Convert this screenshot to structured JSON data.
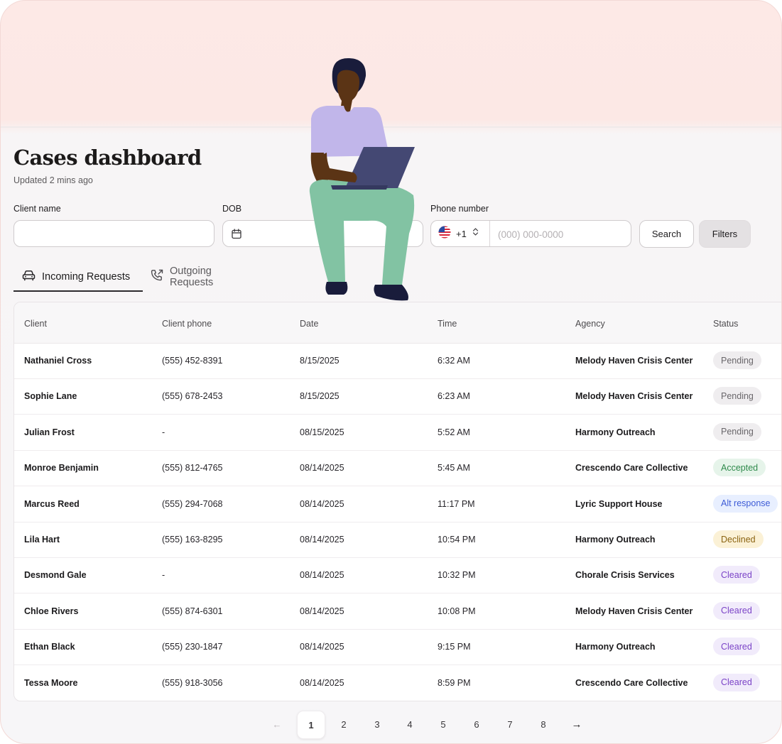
{
  "page": {
    "title": "Cases dashboard",
    "updated": "Updated 2 mins ago"
  },
  "search_form": {
    "client_name_label": "Client name",
    "client_name_value": "",
    "dob_label": "DOB",
    "dob_value": "",
    "phone_label": "Phone number",
    "country_code": "+1",
    "phone_placeholder": "(000) 000-0000",
    "phone_value": "",
    "search_button": "Search",
    "filters_button": "Filters"
  },
  "tabs": [
    {
      "label": "Incoming Requests",
      "icon": "car-icon",
      "active": true
    },
    {
      "label": "Outgoing Requests",
      "icon": "phone-outgoing-icon",
      "active": false
    }
  ],
  "table": {
    "columns": [
      "Client",
      "Client phone",
      "Date",
      "Time",
      "Agency",
      "Status"
    ],
    "rows": [
      {
        "client": "Nathaniel Cross",
        "phone": "(555) 452-8391",
        "date": "8/15/2025",
        "time": "6:32 AM",
        "agency": "Melody Haven Crisis Center",
        "status": "Pending"
      },
      {
        "client": "Sophie Lane",
        "phone": "(555) 678-2453",
        "date": "8/15/2025",
        "time": "6:23 AM",
        "agency": "Melody Haven Crisis Center",
        "status": "Pending"
      },
      {
        "client": "Julian Frost",
        "phone": "-",
        "date": "08/15/2025",
        "time": "5:52 AM",
        "agency": "Harmony Outreach",
        "status": "Pending"
      },
      {
        "client": "Monroe Benjamin",
        "phone": "(555) 812-4765",
        "date": "08/14/2025",
        "time": "5:45 AM",
        "agency": "Crescendo Care Collective",
        "status": "Accepted"
      },
      {
        "client": "Marcus Reed",
        "phone": "(555) 294-7068",
        "date": "08/14/2025",
        "time": "11:17 PM",
        "agency": "Lyric Support House",
        "status": "Alt response"
      },
      {
        "client": "Lila Hart",
        "phone": "(555) 163-8295",
        "date": "08/14/2025",
        "time": "10:54 PM",
        "agency": "Harmony Outreach",
        "status": "Declined"
      },
      {
        "client": "Desmond Gale",
        "phone": "-",
        "date": "08/14/2025",
        "time": "10:32 PM",
        "agency": "Chorale Crisis Services",
        "status": "Cleared"
      },
      {
        "client": "Chloe Rivers",
        "phone": "(555) 874-6301",
        "date": "08/14/2025",
        "time": "10:08 PM",
        "agency": "Melody Haven Crisis Center",
        "status": "Cleared"
      },
      {
        "client": "Ethan Black",
        "phone": "(555) 230-1847",
        "date": "08/14/2025",
        "time": "9:15 PM",
        "agency": "Harmony Outreach",
        "status": "Cleared"
      },
      {
        "client": "Tessa Moore",
        "phone": "(555) 918-3056",
        "date": "08/14/2025",
        "time": "8:59 PM",
        "agency": "Crescendo Care Collective",
        "status": "Cleared"
      }
    ]
  },
  "pagination": {
    "prev": "←",
    "next": "→",
    "pages": [
      "1",
      "2",
      "3",
      "4",
      "5",
      "6",
      "7",
      "8"
    ],
    "current": "1"
  },
  "colors": {
    "hero_background": "#fde9e6",
    "pending": "#6a676b",
    "accepted": "#2f8a4c",
    "alt_response": "#3d5bd6",
    "declined": "#8b6412",
    "cleared": "#7b43c7"
  }
}
